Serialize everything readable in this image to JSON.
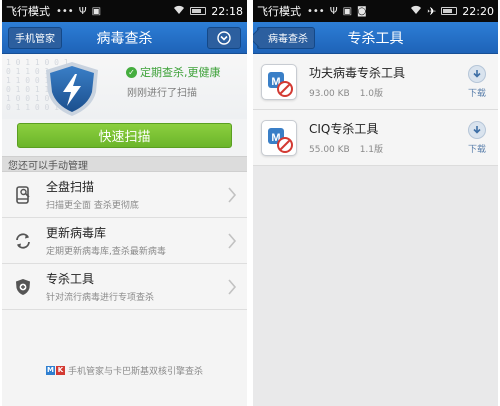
{
  "left": {
    "status_bar": {
      "mode": "飞行模式",
      "dots": "•••",
      "time": "22:18"
    },
    "app_bar": {
      "back_label": "手机管家",
      "title": "病毒查杀"
    },
    "hero": {
      "status": "定期查杀,更健康",
      "last_scan": "刚刚进行了扫描",
      "status_color": "#3fa23a"
    },
    "quick_scan_label": "快速扫描",
    "section_label": "您还可以手动管理",
    "menu": [
      {
        "title": "全盘扫描",
        "desc": "扫描更全面 查杀更彻底",
        "icon": "phone-scan-icon"
      },
      {
        "title": "更新病毒库",
        "desc": "定期更新病毒库,查杀最新病毒",
        "icon": "refresh-icon"
      },
      {
        "title": "专杀工具",
        "desc": "针对流行病毒进行专项查杀",
        "icon": "shield-plus-icon"
      }
    ],
    "footer": "手机管家与卡巴斯基双核引擎查杀",
    "brand_letters": [
      "M",
      "K"
    ]
  },
  "right": {
    "status_bar": {
      "mode": "飞行模式",
      "dots": "•••",
      "time": "22:20"
    },
    "app_bar": {
      "back_label": "病毒查杀",
      "title": "专杀工具"
    },
    "tools": [
      {
        "name": "功夫病毒专杀工具",
        "size": "93.00 KB",
        "version": "1.0版",
        "download_label": "下载"
      },
      {
        "name": "CIQ专杀工具",
        "size": "55.00 KB",
        "version": "1.1版",
        "download_label": "下载"
      }
    ]
  },
  "colors": {
    "appbar_blue": "#2d7ed6",
    "quick_green": "#7bc235",
    "statusbar": "#0a0a0a"
  }
}
